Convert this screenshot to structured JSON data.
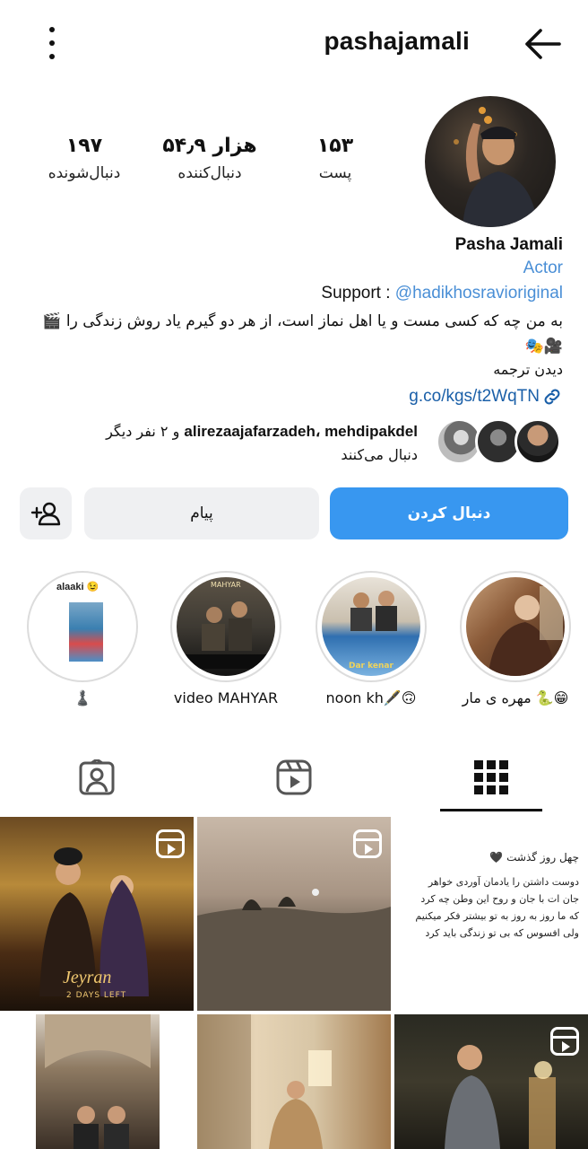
{
  "header": {
    "username": "pashajamali"
  },
  "stats": {
    "posts": {
      "value": "۱۵۳",
      "label": "پست"
    },
    "followers": {
      "value": "۵۴٫۹ هزار",
      "label": "دنبال‌کننده"
    },
    "following": {
      "value": "۱۹۷",
      "label": "دنبال‌شونده"
    }
  },
  "bio": {
    "name": "Pasha Jamali",
    "category": "Actor",
    "support_prefix": "Support : ",
    "support_handle": "@hadikhosravioriginal",
    "text_line1": "به من چه که کسی مست و یا اهل نماز است، از هر دو گیرم یاد روش زندگی را 🎬",
    "text_line2": "🎥🎭",
    "translate": "دیدن ترجمه",
    "link": "g.co/kgs/t2WqTN"
  },
  "followed_by": {
    "names": "alirezaajafarzadeh، mehdipakdel",
    "suffix": " و ۲ نفر دیگر",
    "line2": "دنبال می‌کنند"
  },
  "actions": {
    "follow": "دنبال کردن",
    "message": "پیام"
  },
  "highlights": [
    {
      "label": "مهره ی مار 🐍😁"
    },
    {
      "label": "noon kh🖋️🙃"
    },
    {
      "label": "video MAHYAR"
    },
    {
      "label": "♟️",
      "overlay": "alaaki 😉"
    }
  ],
  "highlight_texts": {
    "mahyar_caption": "MAHYAR",
    "noon_caption": "Dar kenar"
  },
  "grid": {
    "post1_title": "Jeyran",
    "post1_subtitle": "2 DAYS LEFT",
    "text_post_title": "چهل روز گذشت 🖤",
    "text_post_lines": [
      "دوست داشتن را یادمان آوردی خواهر",
      "جان ات با جان و روح این وطن چه کرد",
      "که ما روز به روز به تو بیشتر فکر میکنیم",
      "ولی افسوس که بی تو زندگی باید کرد"
    ]
  }
}
